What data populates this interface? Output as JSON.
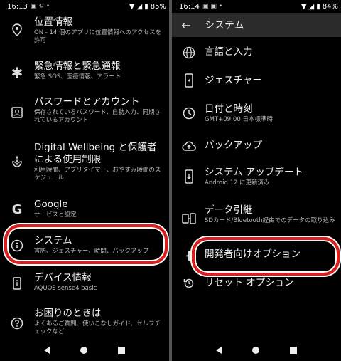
{
  "left": {
    "status": {
      "time": "16:13",
      "battery": "85%"
    },
    "items": [
      {
        "title": "位置情報",
        "sub": "ON - 14 個のアプリに位置情報へのアクセスを許可",
        "icon": "location-icon"
      },
      {
        "title": "緊急情報と緊急通報",
        "sub": "緊急 SOS、医療情報、アラート",
        "icon": "asterisk-icon"
      },
      {
        "title": "パスワードとアカウント",
        "sub": "保存されているパスワード、自動入力、同期されているアカウント",
        "icon": "account-box-icon"
      },
      {
        "title": "Digital Wellbeing と保護者による使用制限",
        "sub": "利用時間、アプリタイマー、おやすみ時間のスケジュール",
        "icon": "wellbeing-icon"
      },
      {
        "title": "Google",
        "sub": "サービスと設定",
        "icon": "google-icon"
      },
      {
        "title": "システム",
        "sub": "言語、ジェスチャー、時間、バックアップ",
        "icon": "info-icon"
      },
      {
        "title": "デバイス情報",
        "sub": "AQUOS sense4 basic",
        "icon": "phone-info-icon"
      },
      {
        "title": "お困りのときは",
        "sub": "よくあるご質問、使いこなしガイド、セルフチェックなど",
        "icon": "help-icon"
      }
    ]
  },
  "right": {
    "status": {
      "time": "16:14",
      "battery": "84%"
    },
    "appbar_title": "システム",
    "items": [
      {
        "title": "言語と入力",
        "sub": "",
        "icon": "globe-icon"
      },
      {
        "title": "ジェスチャー",
        "sub": "",
        "icon": "gesture-phone-icon"
      },
      {
        "title": "日付と時刻",
        "sub": "GMT+09:00 日本標準時",
        "icon": "clock-icon"
      },
      {
        "title": "バックアップ",
        "sub": "",
        "icon": "cloud-upload-icon"
      },
      {
        "title": "システム アップデート",
        "sub": "Android 12 に更新済み",
        "icon": "system-update-icon"
      },
      {
        "title": "データ引継",
        "sub": "SDカード/Bluetooth経由でのデータの取り込み",
        "icon": "data-transfer-icon"
      },
      {
        "title": "開発者向けオプション",
        "sub": "",
        "icon": "code-braces-icon"
      },
      {
        "title": "リセット オプション",
        "sub": "",
        "icon": "reset-icon"
      }
    ]
  },
  "colors": {
    "highlight_ring": "#e01b1b",
    "background": "#000000",
    "appbar": "#2b2b2b"
  }
}
